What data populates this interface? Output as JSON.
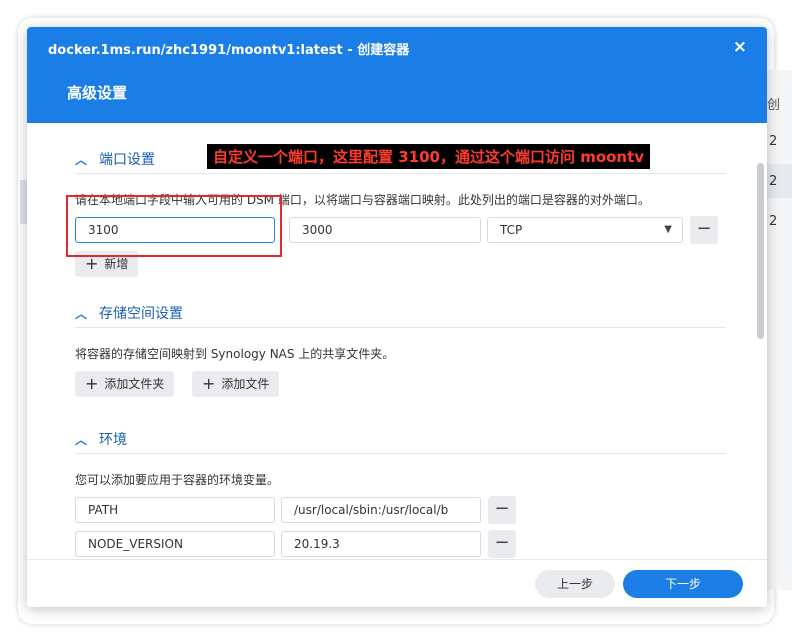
{
  "background": {
    "right_column_header": "创",
    "right_column_cells": [
      "2",
      "2",
      "2"
    ]
  },
  "dialog": {
    "title": "docker.1ms.run/zhc1991/moontv1:latest - 创建容器",
    "close_label": "×",
    "subtitle": "高级设置",
    "accent_color": "#1a7ee6"
  },
  "annotation": {
    "text": "自定义一个端口，这里配置 3100，通过这个端口访问 moontv",
    "color": "#ff3b30"
  },
  "port_section": {
    "title": "端口设置",
    "description": "请在本地端口字段中输入可用的 DSM 端口，以将端口与容器端口映射。此处列出的端口是容器的对外端口。",
    "local_port": "3100",
    "container_port": "3000",
    "protocol": "TCP",
    "remove_label": "−",
    "add_label": "新增"
  },
  "storage_section": {
    "title": "存储空间设置",
    "description": "将容器的存储空间映射到 Synology NAS 上的共享文件夹。",
    "add_folder_label": "添加文件夹",
    "add_file_label": "添加文件"
  },
  "env_section": {
    "title": "环境",
    "description": "您可以添加要应用于容器的环境变量。",
    "variables": [
      {
        "name": "PATH",
        "value": "/usr/local/sbin:/usr/local/b"
      },
      {
        "name": "NODE_VERSION",
        "value": "20.19.3"
      }
    ],
    "remove_label": "−"
  },
  "footer": {
    "prev_label": "上一步",
    "next_label": "下一步"
  }
}
